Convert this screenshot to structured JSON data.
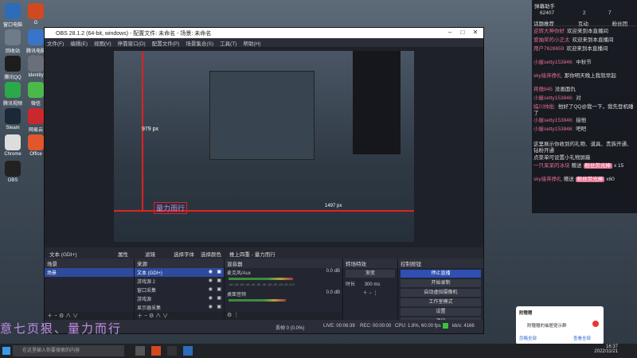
{
  "desktop": {
    "icons": [
      {
        "label": "窗口电脑",
        "color": "#2d6cb8"
      },
      {
        "label": "G",
        "color": "#d14a1f"
      },
      {
        "label": "回收站",
        "color": "#6f7b88"
      },
      {
        "label": "腾讯电脑管家",
        "color": "#3a74c9"
      },
      {
        "label": "腾讯QQ",
        "color": "#1d1d1d"
      },
      {
        "label": "Identity",
        "color": "#6a6f79"
      },
      {
        "label": "腾讯视频",
        "color": "#2aa84a"
      },
      {
        "label": "微信",
        "color": "#4bb84a"
      },
      {
        "label": "Steam",
        "color": "#1b2838"
      },
      {
        "label": "网易云",
        "color": "#c8282e"
      },
      {
        "label": "Chrome",
        "color": "#dddddd"
      },
      {
        "label": "Office",
        "color": "#e2562c"
      },
      {
        "label": "OBS",
        "color": "#222222"
      }
    ]
  },
  "obs": {
    "title": "OBS 28.1.2 (64-bit, windows) - 配置文件: 未命名 - 场景: 未命名",
    "menu": [
      "文件(F)",
      "编辑(E)",
      "视图(V)",
      "停靠窗口(D)",
      "配置文件(P)",
      "场景集合(S)",
      "工具(T)",
      "帮助(H)"
    ],
    "preview": {
      "size_label": "979 px",
      "bottom_label": "1497 px",
      "mic_text": "量力而行"
    },
    "source_toolbar": {
      "selected": "文本 (GDI+)",
      "items": [
        "属性",
        "滤镜",
        "选择字体",
        "选择颜色",
        "推上四重 - 量力而行"
      ]
    },
    "scenes": {
      "header": "场景",
      "items": [
        "场景"
      ]
    },
    "sources": {
      "header": "来源",
      "items": [
        "文本 (GDI+)",
        "游戏源 2",
        "窗口采集",
        "游戏源",
        "显示器采集"
      ]
    },
    "mixer": {
      "header": "混音器",
      "channels": [
        {
          "name": "麦克风/Aux",
          "db": "0.0 dB",
          "level": 0.62
        },
        {
          "name": "桌面音频",
          "db": "0.0 dB",
          "level": 0.55
        }
      ],
      "scale": "-60 -55 -50 -45 -40 -35 -30 -25 -20 -15 -10 -5 0"
    },
    "transitions": {
      "header": "转场特效",
      "type": "渐变",
      "duration_label": "时长",
      "duration": "300 ms"
    },
    "controls": {
      "header": "控制按钮",
      "items": [
        "停止直播",
        "开始录制",
        "启动虚拟摄像机",
        "工作室模式",
        "设置",
        "退出"
      ]
    },
    "status": {
      "dropped": "丢帧 0 (0.0%)",
      "live": "LIVE: 00:06:39",
      "rec": "REC: 00:00:00",
      "cpu": "CPU: 1.8%, 60.00 fps",
      "kbps": "kb/s: 4166"
    }
  },
  "chat": {
    "header": {
      "name": "弹幕助手",
      "count": "62407",
      "gift": "2",
      "like": "7"
    },
    "tabs": [
      "话题推荐",
      "互动",
      "粉丝团"
    ],
    "messages": [
      {
        "nick": "逆转大神你好",
        "text": "欢迎来到本直播间"
      },
      {
        "nick": "爱抽奖的小正太",
        "text": "欢迎来到本直播间"
      },
      {
        "nick": "用户7628659",
        "text": "欢迎来到本直播间"
      },
      {
        "nick": "小屋setty153846:",
        "text": "中秋节"
      },
      {
        "nick": "sky接弃挣扎",
        "text": "那你明天晚上我就早起"
      },
      {
        "nick": "蒋傲845",
        "text": "没画面仇"
      },
      {
        "nick": "小屋setty153846:",
        "text": "对"
      },
      {
        "nick": "临川帅批:",
        "text": "他好了QQ@我一下，我先登机睡了"
      },
      {
        "nick": "小屋setty153846:",
        "text": "接他"
      },
      {
        "nick": "小屋setty153846:",
        "text": "吧吧"
      }
    ],
    "notice": "这里展示你收到的礼物、道具、贵族开通、钻粉开通",
    "notice2": "点菜单可设置小礼物屏蔽",
    "gifts": [
      {
        "nick": "一只呆呆的冰块",
        "text": "赠送",
        "item": "粉丝荧光棒",
        "count": "x 15"
      },
      {
        "nick": "sky接弃挣扎",
        "text": "赠送",
        "item": "粉丝荧光棒",
        "count": "x60"
      }
    ]
  },
  "notification": {
    "title": "附赠赠",
    "body": "附赠赠的抽屉提示群",
    "ignore": "忽略全部",
    "view": "查看全部"
  },
  "overlay_text": "意七页狠、量力而行",
  "taskbar": {
    "search_placeholder": "在这里输入你要搜索的内容",
    "time": "16:37",
    "date": "2022/11/21"
  }
}
